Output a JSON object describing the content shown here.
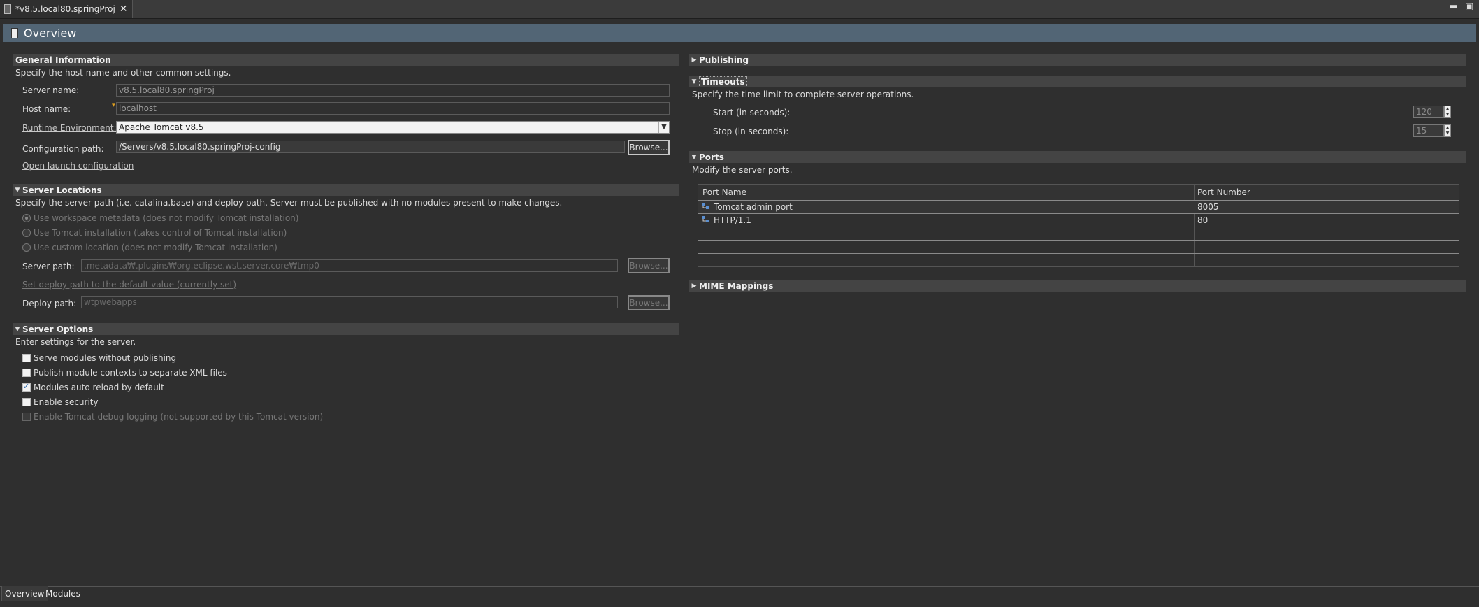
{
  "editor_tab": {
    "title": "*v8.5.local80.springProj"
  },
  "header": {
    "title": "Overview"
  },
  "general": {
    "title": "General Information",
    "description": "Specify the host name and other common settings.",
    "server_name_label": "Server name:",
    "server_name_value": "v8.5.local80.springProj",
    "host_name_label": "Host name:",
    "host_name_value": "localhost",
    "runtime_label": "Runtime Environment:",
    "runtime_value": "Apache Tomcat v8.5",
    "config_path_label": "Configuration path:",
    "config_path_value": "/Servers/v8.5.local80.springProj-config",
    "browse_label": "Browse...",
    "open_launch_label": "Open launch configuration"
  },
  "locations": {
    "title": "Server Locations",
    "description": "Specify the server path (i.e. catalina.base) and deploy path. Server must be published with no modules present to make changes.",
    "radio_workspace": "Use workspace metadata (does not modify Tomcat installation)",
    "radio_tomcat": "Use Tomcat installation (takes control of Tomcat installation)",
    "radio_custom": "Use custom location (does not modify Tomcat installation)",
    "server_path_label": "Server path:",
    "server_path_value": ".metadata₩.plugins₩org.eclipse.wst.server.core₩tmp0",
    "browse_label": "Browse...",
    "set_deploy_label": "Set deploy path to the default value (currently set)",
    "deploy_path_label": "Deploy path:",
    "deploy_path_value": "wtpwebapps"
  },
  "options": {
    "title": "Server Options",
    "description": "Enter settings for the server.",
    "items": [
      {
        "label": "Serve modules without publishing",
        "checked": false,
        "enabled": true
      },
      {
        "label": "Publish module contexts to separate XML files",
        "checked": false,
        "enabled": true
      },
      {
        "label": "Modules auto reload by default",
        "checked": true,
        "enabled": true
      },
      {
        "label": "Enable security",
        "checked": false,
        "enabled": true
      },
      {
        "label": "Enable Tomcat debug logging (not supported by this Tomcat version)",
        "checked": false,
        "enabled": false
      }
    ]
  },
  "publishing": {
    "title": "Publishing"
  },
  "timeouts": {
    "title": "Timeouts",
    "description": "Specify the time limit to complete server operations.",
    "start_label": "Start (in seconds):",
    "start_value": "120",
    "stop_label": "Stop (in seconds):",
    "stop_value": "15"
  },
  "ports": {
    "title": "Ports",
    "description": "Modify the server ports.",
    "columns": [
      "Port Name",
      "Port Number"
    ],
    "rows": [
      {
        "name": "Tomcat admin port",
        "number": "8005"
      },
      {
        "name": "HTTP/1.1",
        "number": "80"
      }
    ]
  },
  "mime": {
    "title": "MIME Mappings"
  },
  "bottom_tabs": [
    "Overview",
    "Modules"
  ]
}
